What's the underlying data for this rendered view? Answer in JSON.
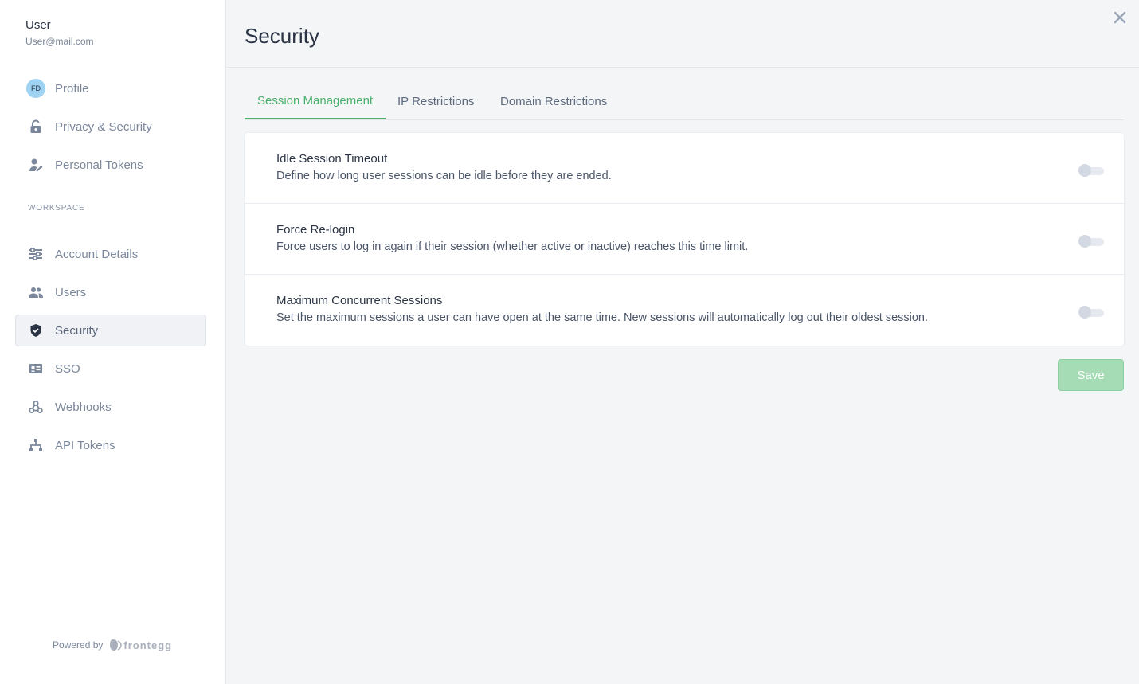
{
  "user": {
    "name": "User",
    "email": "User@mail.com",
    "avatar_initials": "FD"
  },
  "sidebar": {
    "personal_items": [
      {
        "label": "Profile",
        "icon": "avatar-icon"
      },
      {
        "label": "Privacy & Security",
        "icon": "lock-icon"
      },
      {
        "label": "Personal Tokens",
        "icon": "user-key-icon"
      }
    ],
    "section_label": "WORKSPACE",
    "workspace_items": [
      {
        "label": "Account Details",
        "icon": "sliders-icon"
      },
      {
        "label": "Users",
        "icon": "users-icon"
      },
      {
        "label": "Security",
        "icon": "shield-icon",
        "active": true
      },
      {
        "label": "SSO",
        "icon": "id-card-icon"
      },
      {
        "label": "Webhooks",
        "icon": "webhook-icon"
      },
      {
        "label": "API Tokens",
        "icon": "hierarchy-icon"
      }
    ],
    "powered_by": "Powered by",
    "brand": "frontegg"
  },
  "header": {
    "title": "Security"
  },
  "tabs": [
    {
      "label": "Session Management",
      "active": true
    },
    {
      "label": "IP Restrictions"
    },
    {
      "label": "Domain Restrictions"
    }
  ],
  "settings": [
    {
      "title": "Idle Session Timeout",
      "description": "Define how long user sessions can be idle before they are ended.",
      "enabled": false
    },
    {
      "title": "Force Re-login",
      "description": "Force users to log in again if their session (whether active or inactive) reaches this time limit.",
      "enabled": false
    },
    {
      "title": "Maximum Concurrent Sessions",
      "description": "Set the maximum sessions a user can have open at the same time. New sessions will automatically log out their oldest session.",
      "enabled": false
    }
  ],
  "actions": {
    "save_label": "Save"
  },
  "colors": {
    "accent": "#4caf6a",
    "save_disabled": "#a6dcb5",
    "avatar_bg": "#9fd3f3"
  }
}
